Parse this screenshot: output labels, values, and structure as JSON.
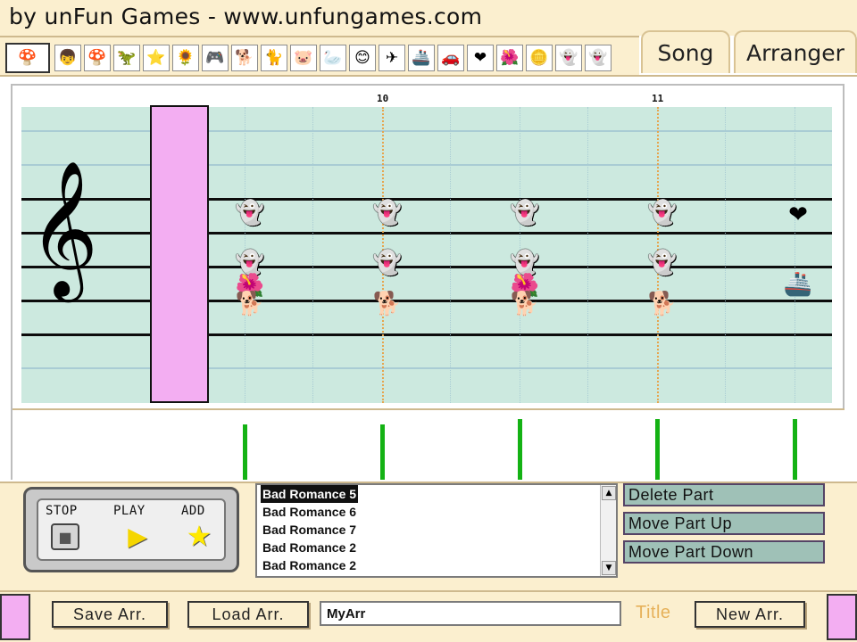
{
  "header": {
    "credit": "by unFun Games - www.unfungames.com"
  },
  "palette": [
    {
      "icon": "mario-icon",
      "glyph": "🍄"
    },
    {
      "icon": "mario-head-icon",
      "glyph": "👦"
    },
    {
      "icon": "mushroom-icon",
      "glyph": "🍄"
    },
    {
      "icon": "yoshi-icon",
      "glyph": "🦖"
    },
    {
      "icon": "star-icon",
      "glyph": "⭐"
    },
    {
      "icon": "fire-flower-icon",
      "glyph": "🌻"
    },
    {
      "icon": "gameboy-icon",
      "glyph": "🎮"
    },
    {
      "icon": "dog-icon",
      "glyph": "🐕"
    },
    {
      "icon": "cat-icon",
      "glyph": "🐈"
    },
    {
      "icon": "pig-icon",
      "glyph": "🐷"
    },
    {
      "icon": "swan-icon",
      "glyph": "🦢"
    },
    {
      "icon": "face-icon",
      "glyph": "😊"
    },
    {
      "icon": "plane-icon",
      "glyph": "✈"
    },
    {
      "icon": "ship-icon",
      "glyph": "🚢"
    },
    {
      "icon": "car-icon",
      "glyph": "🚗"
    },
    {
      "icon": "heart-icon",
      "glyph": "❤"
    },
    {
      "icon": "piranha-icon",
      "glyph": "🌺"
    },
    {
      "icon": "coin-icon",
      "glyph": "🪙"
    },
    {
      "icon": "shyguy-icon",
      "glyph": "👻"
    },
    {
      "icon": "boo-icon",
      "glyph": "👻"
    }
  ],
  "tabs": {
    "song": "Song",
    "arranger": "Arranger"
  },
  "staff": {
    "measures": [
      "10",
      "11"
    ],
    "clef_glyph": "𝄞",
    "notes": [
      {
        "glyph": "👻",
        "kind": "boo"
      },
      {
        "glyph": "👻",
        "kind": "boo"
      },
      {
        "glyph": "🌺",
        "kind": "piranha"
      },
      {
        "glyph": "🐕",
        "kind": "dog"
      },
      {
        "glyph": "👻",
        "kind": "boo"
      },
      {
        "glyph": "👻",
        "kind": "boo"
      },
      {
        "glyph": "🐕",
        "kind": "dog"
      },
      {
        "glyph": "👻",
        "kind": "boo"
      },
      {
        "glyph": "👻",
        "kind": "boo"
      },
      {
        "glyph": "🌺",
        "kind": "piranha"
      },
      {
        "glyph": "🐕",
        "kind": "dog"
      },
      {
        "glyph": "👻",
        "kind": "boo"
      },
      {
        "glyph": "👻",
        "kind": "boo"
      },
      {
        "glyph": "🐕",
        "kind": "dog"
      },
      {
        "glyph": "❤",
        "kind": "heart"
      },
      {
        "glyph": "🚢",
        "kind": "ship"
      }
    ]
  },
  "transport": {
    "stop_label": "STOP",
    "play_label": "PLAY",
    "add_label": "ADD",
    "stop_glyph": "■",
    "play_glyph": "▶",
    "add_glyph": "★"
  },
  "part_list": {
    "items": [
      "Bad Romance 5",
      "Bad Romance 6",
      "Bad Romance 7",
      "Bad Romance 2",
      "Bad Romance 2"
    ],
    "selected_index": 0,
    "scroll_up": "▲",
    "scroll_down": "▼"
  },
  "part_buttons": {
    "delete": "Delete Part",
    "move_up": "Move Part Up",
    "move_down": "Move Part Down"
  },
  "bottom": {
    "save": "Save  Arr.",
    "load": "Load  Arr.",
    "title_value": "MyArr",
    "title_label": "Title",
    "new": "New  Arr."
  },
  "colors": {
    "cream": "#fbefcf",
    "staff_bg": "#cce9df",
    "pink": "#f3aef2",
    "velocity": "#14b214",
    "button": "#9fc1b7",
    "title_label": "#e6b15a"
  }
}
